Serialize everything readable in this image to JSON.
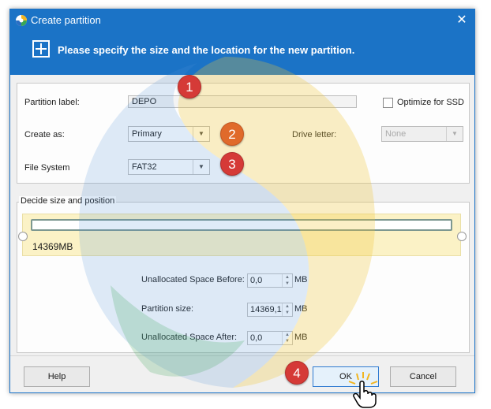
{
  "window": {
    "title": "Create partition",
    "close_symbol": "✕"
  },
  "banner": {
    "text": "Please specify the size and the location for the new partition."
  },
  "fields": {
    "partition_label": {
      "label": "Partition label:",
      "value": "DEPO"
    },
    "optimize_ssd": {
      "label": "Optimize for SSD",
      "checked": false
    },
    "create_as": {
      "label": "Create as:",
      "value": "Primary"
    },
    "drive_letter": {
      "label": "Drive letter:",
      "value": "None"
    },
    "file_system": {
      "label": "File System",
      "value": "FAT32"
    }
  },
  "size_group": {
    "legend": "Decide size and position",
    "bar_size": "14369MB",
    "bar_fill_fraction": 1.0,
    "unallocated_before": {
      "label": "Unallocated Space Before:",
      "value": "0,0",
      "unit": "MB"
    },
    "partition_size": {
      "label": "Partition size:",
      "value": "14369,1",
      "unit": "MB"
    },
    "unallocated_after": {
      "label": "Unallocated Space After:",
      "value": "0,0",
      "unit": "MB"
    }
  },
  "buttons": {
    "help": "Help",
    "ok": "OK",
    "cancel": "Cancel"
  },
  "markers": [
    "1",
    "2",
    "3",
    "4"
  ],
  "icons": {
    "app": "app-logo-icon",
    "plus": "plus-icon",
    "dropdown": "chevron-down-icon",
    "cursor": "hand-pointer-icon"
  },
  "colors": {
    "title_bar": "#1b73c6",
    "marker_red": "#d53a37",
    "marker_orange": "#e06a2b",
    "bar_area": "#fbf2c6"
  }
}
